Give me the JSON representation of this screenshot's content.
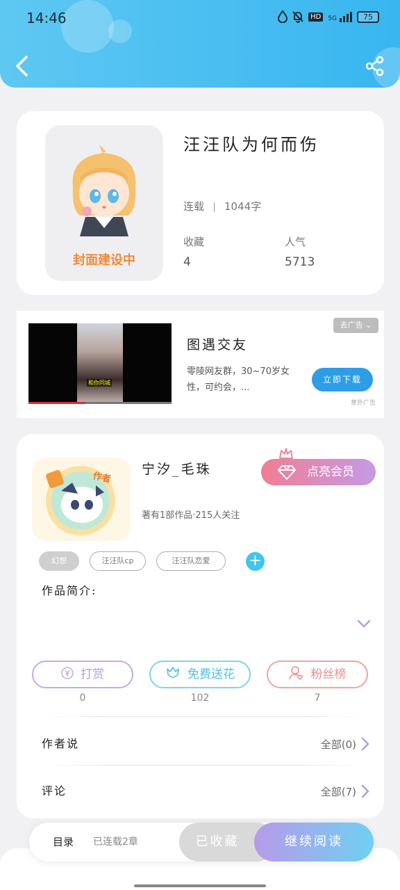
{
  "status_bar": {
    "time": "14:46",
    "network": "5G",
    "hd": "HD",
    "battery": "75"
  },
  "colors": {
    "header": "#38b6f0",
    "vip": "#f07e93",
    "flower": "#3fc5f0",
    "fans": "#f08a8a",
    "reward": "#c59ae6"
  },
  "book": {
    "cover_label": "封面建设中",
    "title": "汪汪队为何而伤",
    "status": "连载",
    "word_count": "1044字",
    "collect_label": "收藏",
    "collect_value": "4",
    "popularity_label": "人气",
    "popularity_value": "5713"
  },
  "ad": {
    "title": "图遇交友",
    "description": "零陵网友群，30~70岁女性，可约会，...",
    "close_label": "去广告",
    "download_label": "立即下载",
    "tag": "意外广告",
    "video_caption": "和你同城"
  },
  "author": {
    "name": "宁汐_毛珠",
    "meta": "著有1部作品·215人关注",
    "vip_label": "点亮会员",
    "avatar_badge": "作者",
    "tags": [
      "幻想",
      "汪汪队cp",
      "汪汪队恋爱"
    ],
    "intro_label": "作品简介:"
  },
  "actions": {
    "reward": {
      "label": "打赏",
      "count": "0"
    },
    "flower": {
      "label": "免费送花",
      "count": "102"
    },
    "fans": {
      "label": "粉丝榜",
      "count": "7"
    }
  },
  "author_says": {
    "label": "作者说",
    "value": "全部(0)"
  },
  "comments": {
    "label": "评论",
    "value": "全部(7)"
  },
  "bottom_bar": {
    "toc_label": "目录",
    "toc_status": "已连载2章",
    "collected_label": "已收藏",
    "read_label": "继续阅读"
  }
}
